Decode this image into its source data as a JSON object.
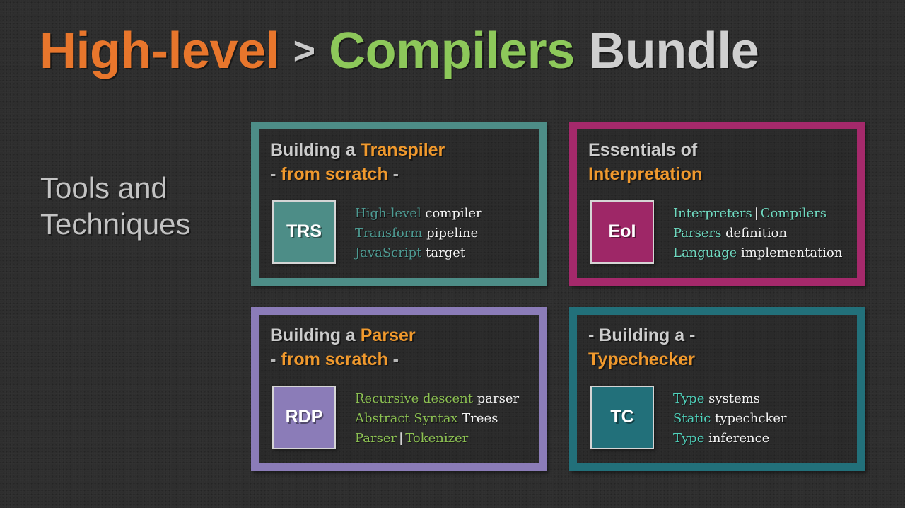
{
  "title": {
    "part1": "High-level",
    "chevron": ">",
    "part2": "Compilers",
    "part3": "Bundle"
  },
  "side_label": "Tools and\nTechniques",
  "cards": [
    {
      "id": "transpiler",
      "accent_hex": "#4d8d87",
      "badge": "TRS",
      "badge_title": "Transpiler from scratch",
      "head_line1_plain": "Building a ",
      "head_line1_accent": "Transpiler",
      "head_line2_dash_left": "- ",
      "head_line2_accent": "from scratch",
      "head_line2_dash_right": " -",
      "bullets": [
        {
          "accent": "High-level",
          "plain": " compiler"
        },
        {
          "accent": "Transform",
          "plain": " pipeline"
        },
        {
          "accent": "JavaScript",
          "plain": " target"
        }
      ]
    },
    {
      "id": "interpretation",
      "accent_hex": "#a5296b",
      "badge": "EoI",
      "badge_title": "Essentials of Interpretation",
      "head_line1_plain": "Essentials of",
      "head_line1_accent": "",
      "head_line2_dash_left": "",
      "head_line2_accent": "Interpretation",
      "head_line2_dash_right": "",
      "bullets": [
        {
          "accent": "Interpreters",
          "pipe": "|",
          "accent2": "Compilers",
          "plain": ""
        },
        {
          "accent": "Parsers",
          "plain": " definition"
        },
        {
          "accent": "Language",
          "plain": " implementation"
        }
      ]
    },
    {
      "id": "parser",
      "accent_hex": "#8b7cb8",
      "badge": "RDP",
      "badge_title": "Recursive descent parser",
      "head_line1_plain": "Building a ",
      "head_line1_accent": "Parser",
      "head_line2_dash_left": "- ",
      "head_line2_accent": "from scratch",
      "head_line2_dash_right": " -",
      "bullets": [
        {
          "accent": "Recursive descent",
          "plain": " parser"
        },
        {
          "accent": "Abstract Syntax",
          "plain": " Trees"
        },
        {
          "accent": "Parser",
          "pipe": "|",
          "accent2": "Tokenizer",
          "plain": ""
        }
      ]
    },
    {
      "id": "typechecker",
      "accent_hex": "#22707a",
      "badge": "TC",
      "badge_title": "Typechecker",
      "head_line1_plain": "- Building a -",
      "head_line1_accent": "",
      "head_line2_dash_left": "",
      "head_line2_accent": "Typechecker",
      "head_line2_dash_right": "",
      "bullets": [
        {
          "accent": "Type",
          "plain": " systems"
        },
        {
          "accent": "Static",
          "plain": " typechcker"
        },
        {
          "accent": "Type",
          "plain": " inference"
        }
      ]
    }
  ]
}
